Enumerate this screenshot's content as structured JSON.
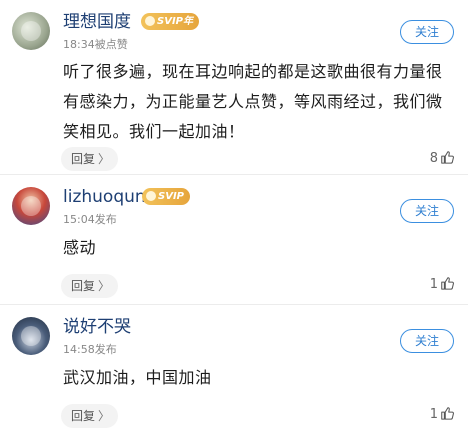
{
  "comments": [
    {
      "username": "理想国度",
      "badge": "SVIP年",
      "time": "18:34被点赞",
      "follow_label": "关注",
      "text": "听了很多遍，现在耳边响起的都是这歌曲很有力量很有感染力，为正能量艺人点赞，等风雨经过，我们微笑相见。我们一起加油！",
      "reply_label": "回复",
      "reply_chevron": "〉",
      "likes": "8",
      "like_icon": "thumbs-up-icon"
    },
    {
      "username": "lizhuoqun",
      "badge": "SVIP",
      "time": "15:04发布",
      "follow_label": "关注",
      "text": "感动",
      "reply_label": "回复",
      "reply_chevron": "〉",
      "likes": "1",
      "like_icon": "thumbs-up-icon"
    },
    {
      "username": "说好不哭",
      "time": "14:58发布",
      "follow_label": "关注",
      "text": "武汉加油，中国加油",
      "reply_label": "回复",
      "reply_chevron": "〉",
      "likes": "1",
      "like_icon": "thumbs-up-icon"
    }
  ],
  "colors": {
    "username": "#1e3f73",
    "follow_border": "#3b8fe0",
    "badge_gold": "#e6a53c"
  }
}
